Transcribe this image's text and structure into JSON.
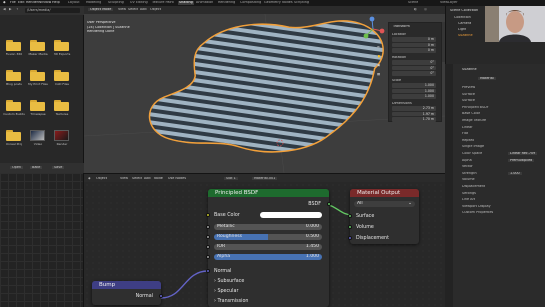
{
  "topbar": {
    "menus": [
      "File",
      "Edit",
      "Render",
      "Window",
      "Help"
    ],
    "workspaces": [
      "Layout",
      "Modeling",
      "Sculpting",
      "UV Editing",
      "Texture Paint",
      "Shading",
      "Animation",
      "Rendering",
      "Compositing",
      "Geometry Nodes",
      "Scripting"
    ],
    "active_workspace": "Shading",
    "scene": "Scene",
    "view_layer": "ViewLayer"
  },
  "filebrowser": {
    "path": "/Users/media/",
    "items": [
      {
        "label": "Fusion 360",
        "kind": "folder"
      },
      {
        "label": "Maker Media",
        "kind": "folder"
      },
      {
        "label": "3D Exports",
        "kind": "folder"
      },
      {
        "label": "Blog posts",
        "kind": "folder"
      },
      {
        "label": "My Print Files",
        "kind": "folder"
      },
      {
        "label": "CAD Files",
        "kind": "folder"
      },
      {
        "label": "Custom Builds",
        "kind": "folder"
      },
      {
        "label": "Timelapse",
        "kind": "folder"
      },
      {
        "label": "Textures",
        "kind": "folder"
      },
      {
        "label": "Unreal Proj",
        "kind": "folder"
      },
      {
        "label": "Video",
        "kind": "thumb"
      },
      {
        "label": "Render",
        "kind": "thumb"
      }
    ],
    "bottom": [
      "Open",
      "Bake",
      "Save"
    ]
  },
  "viewport": {
    "mode": "Object Mode",
    "menus": [
      "View",
      "Select",
      "Add",
      "Object"
    ],
    "info_lines": [
      "User Perspective",
      "(24) Collection | Suzanne",
      "Rendering Done"
    ]
  },
  "npanel": {
    "title": "Transform",
    "location_label": "Location",
    "rotation_label": "Rotation",
    "scale_label": "Scale",
    "dimensions_label": "Dimensions",
    "loc": [
      "0 m",
      "0 m",
      "0 m"
    ],
    "rot": [
      "0°",
      "0°",
      "0°"
    ],
    "scale": [
      "1.000",
      "1.000",
      "1.000"
    ],
    "dims": [
      "2.73 m",
      "1.97 m",
      "1.70 m"
    ]
  },
  "outliner": {
    "title": "Scene Collection",
    "rows": [
      "Collection",
      "Camera",
      "Light",
      "Suzanne"
    ]
  },
  "properties": {
    "object_name": "Suzanne",
    "material_name": "Material",
    "rows": [
      "Preview",
      "Surface",
      "Surface",
      "Principled BSDF",
      "Base Color",
      "Image Texture",
      "Linear",
      "Flat",
      "Repeat",
      "Single Image",
      "Color Space",
      "Alpha",
      "Vector",
      "Strength",
      "Volume",
      "Displacement",
      "Settings",
      "Line Art",
      "Viewport Display",
      "Custom Properties"
    ],
    "color_space_value": "Linear Rec.709",
    "alpha_value": "Premultiplied",
    "strength_value": "1.000"
  },
  "node_editor": {
    "header_items": [
      "Object",
      "View",
      "Select",
      "Add",
      "Node",
      "Use Nodes"
    ],
    "slot": "Slot 1",
    "material": "Material.001"
  },
  "principled": {
    "title": "Principled BSDF",
    "output": "BSDF",
    "base_color_label": "Base Color",
    "fields": [
      {
        "label": "Metallic",
        "value": "0.000",
        "fill": 0.0
      },
      {
        "label": "Roughness",
        "value": "0.500",
        "fill": 0.5
      },
      {
        "label": "IOR",
        "value": "1.450",
        "fill": 0.0
      },
      {
        "label": "Alpha",
        "value": "1.000",
        "fill": 1.0
      }
    ],
    "normal_label": "Normal",
    "collapsed": [
      "Subsurface",
      "Specular",
      "Transmission"
    ]
  },
  "material_output": {
    "title": "Material Output",
    "target": "All",
    "inputs": [
      "Surface",
      "Volume",
      "Displacement"
    ]
  },
  "bump": {
    "title": "Bump",
    "output": "Normal"
  },
  "colors": {
    "bsdf_header": "#1e6b2e",
    "output_header": "#7a2a2a",
    "bump_header": "#3e3e84",
    "socket_shader": "#63c763",
    "socket_value": "#a1a1a1",
    "socket_color": "#c7c729",
    "socket_vector": "#6363c7",
    "field_fill": "#4772b3",
    "object_outline": "#f2a03a"
  }
}
